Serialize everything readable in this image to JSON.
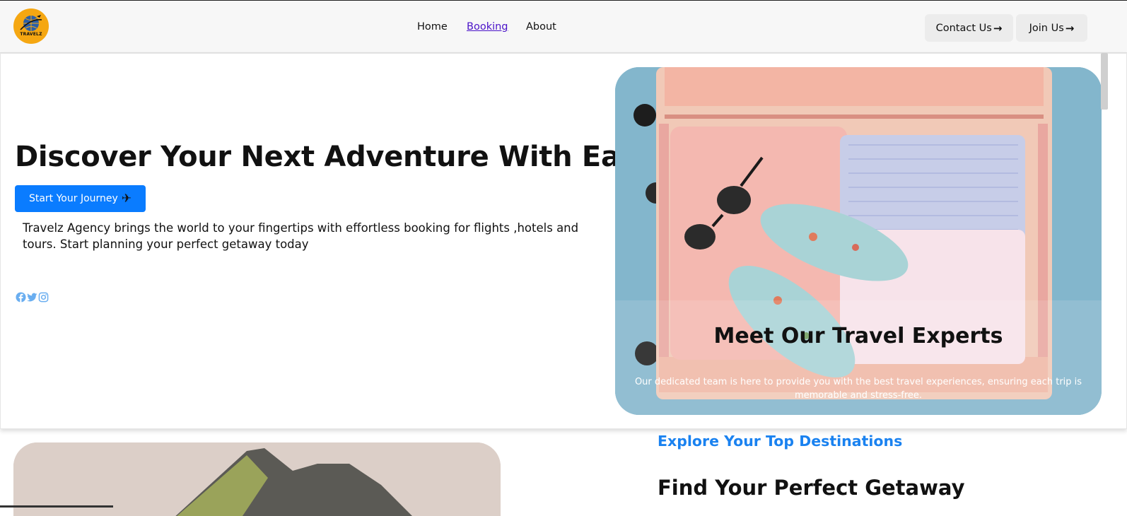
{
  "brand": {
    "logo_text": "TRAVELZ",
    "accent_color": "#f5a712"
  },
  "nav": {
    "items": [
      {
        "label": "Home",
        "active": false
      },
      {
        "label": "Booking",
        "active": true
      },
      {
        "label": "About",
        "active": false
      }
    ]
  },
  "header_buttons": {
    "contact": "Contact Us",
    "join": "Join Us",
    "arrow_icon": "arrow-right-icon"
  },
  "hero": {
    "headline": "Discover Your Next Adventure With Ease",
    "cta_label": "Start Your Journey",
    "cta_icon": "airplane-icon",
    "cta_color": "#0a7cff",
    "description": "Travelz Agency brings the world to your fingertips with effortless booking for flights ,hotels and tours. Start planning your perfect getaway today",
    "social_icons": [
      "facebook-icon",
      "twitter-icon",
      "instagram-icon"
    ]
  },
  "experts_card": {
    "title": "Meet Our Travel Experts",
    "text": "Our dedicated team is here to provide you with the best travel experiences, ensuring each trip is memorable and stress-free."
  },
  "destinations": {
    "eyebrow": "Explore Your Top Destinations",
    "title": "Find Your Perfect Getaway",
    "eyebrow_color": "#1a82f0"
  }
}
